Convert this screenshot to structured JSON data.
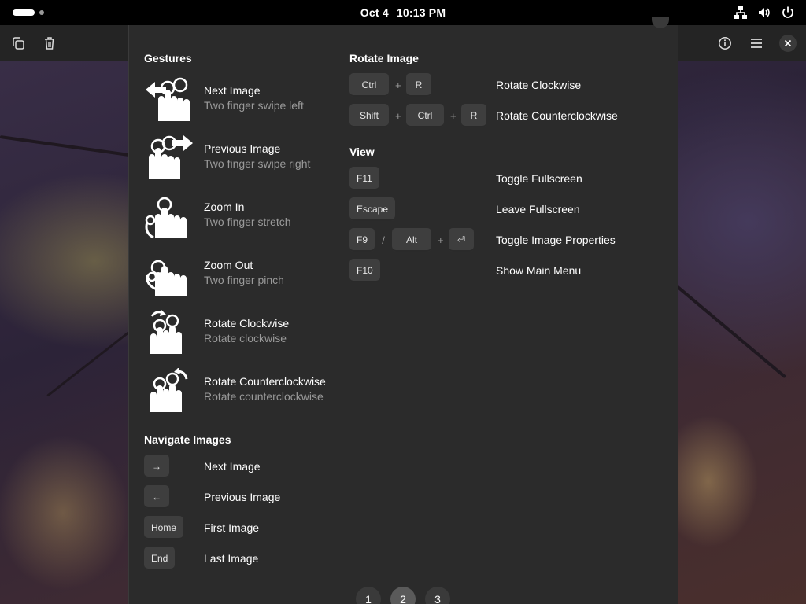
{
  "topbar": {
    "date": "Oct 4",
    "time": "10:13 PM",
    "icons": [
      "network-icon",
      "volume-icon",
      "power-icon"
    ]
  },
  "headerbar": {
    "left_icons": [
      "copy-icon",
      "trash-icon"
    ],
    "right_icons": [
      "info-icon",
      "hamburger-menu-icon",
      "close-icon"
    ]
  },
  "dialog": {
    "gestures": {
      "title": "Gestures",
      "items": [
        {
          "title": "Next Image",
          "subtitle": "Two finger swipe left",
          "icon": "swipe-left-gesture-icon"
        },
        {
          "title": "Previous Image",
          "subtitle": "Two finger swipe right",
          "icon": "swipe-right-gesture-icon"
        },
        {
          "title": "Zoom In",
          "subtitle": "Two finger stretch",
          "icon": "stretch-gesture-icon"
        },
        {
          "title": "Zoom Out",
          "subtitle": "Two finger pinch",
          "icon": "pinch-gesture-icon"
        },
        {
          "title": "Rotate Clockwise",
          "subtitle": "Rotate clockwise",
          "icon": "rotate-cw-gesture-icon"
        },
        {
          "title": "Rotate Counterclockwise",
          "subtitle": "Rotate counterclockwise",
          "icon": "rotate-ccw-gesture-icon"
        }
      ]
    },
    "navigate": {
      "title": "Navigate Images",
      "items": [
        {
          "key": "→",
          "label": "Next Image"
        },
        {
          "key": "←",
          "label": "Previous Image"
        },
        {
          "key": "Home",
          "label": "First Image"
        },
        {
          "key": "End",
          "label": "Last Image"
        }
      ]
    },
    "rotate": {
      "title": "Rotate Image",
      "items": [
        {
          "keys": [
            "Ctrl",
            "R"
          ],
          "label": "Rotate Clockwise"
        },
        {
          "keys": [
            "Shift",
            "Ctrl",
            "R"
          ],
          "label": "Rotate Counterclockwise"
        }
      ]
    },
    "view": {
      "title": "View",
      "items": [
        {
          "keys": [
            "F11"
          ],
          "label": "Toggle Fullscreen"
        },
        {
          "keys": [
            "Escape"
          ],
          "label": "Leave Fullscreen"
        },
        {
          "keys": [
            "F9",
            "Alt",
            "⏎"
          ],
          "separator": "/",
          "label": "Toggle Image Properties"
        },
        {
          "keys": [
            "F10"
          ],
          "label": "Show Main Menu"
        }
      ]
    },
    "plus_sign": "+",
    "pages": [
      "1",
      "2",
      "3"
    ],
    "active_page": "2"
  }
}
